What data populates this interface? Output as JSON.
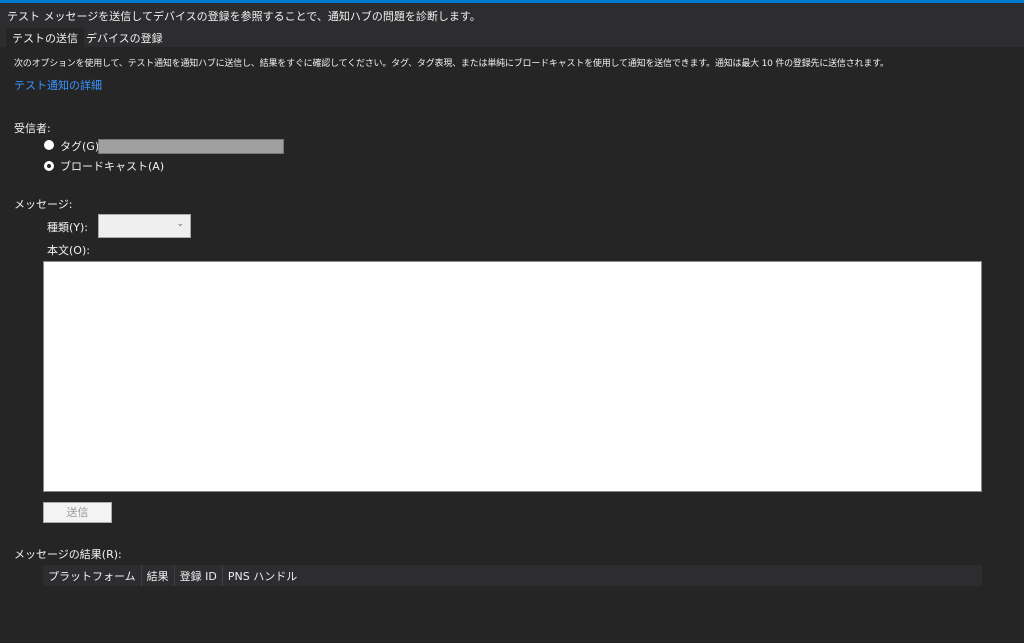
{
  "header": {
    "title": "テスト メッセージを送信してデバイスの登録を参照することで、通知ハブの問題を診断します。"
  },
  "tabs": [
    {
      "label": "テストの送信"
    },
    {
      "label": "デバイスの登録"
    }
  ],
  "description": "次のオプションを使用して、テスト通知を通知ハブに送信し、結果をすぐに確認してください。タグ、タグ表現、または単純にブロードキャストを使用して通知を送信できます。通知は最大 10 件の登録先に送信されます。",
  "link": "テスト通知の詳細",
  "recipients": {
    "label": "受信者:",
    "tag_label": "タグ(G)",
    "broadcast_label": "ブロードキャスト(A)",
    "selected": "broadcast",
    "tag_value": ""
  },
  "message": {
    "label": "メッセージ:",
    "type_label": "種類(Y):",
    "type_value": "",
    "body_label": "本文(O):",
    "body_value": ""
  },
  "send_label": "送信",
  "results": {
    "label": "メッセージの結果(R):",
    "columns": [
      "プラットフォーム",
      "結果",
      "登録 ID",
      "PNS ハンドル"
    ]
  }
}
